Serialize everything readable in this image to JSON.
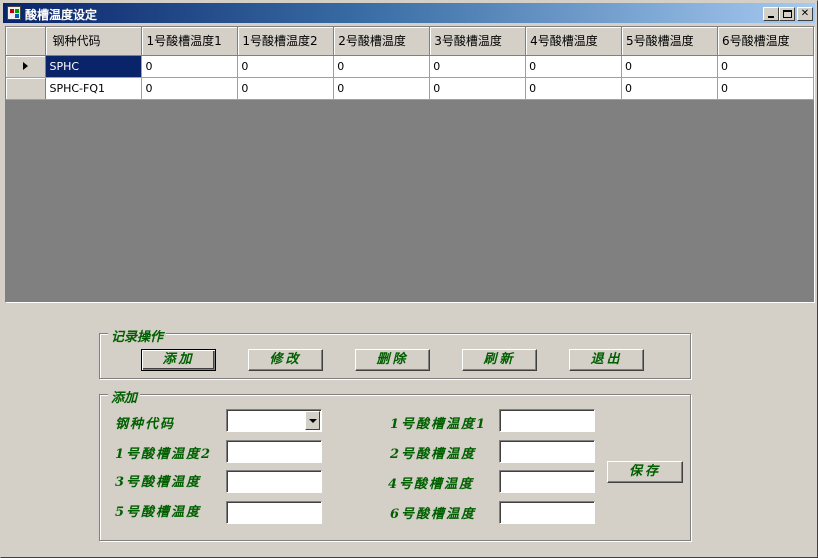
{
  "window": {
    "title": "酸槽温度设定"
  },
  "grid": {
    "columns": [
      "钢种代码",
      "1号酸槽温度1",
      "1号酸槽温度2",
      "2号酸槽温度",
      "3号酸槽温度",
      "4号酸槽温度",
      "5号酸槽温度",
      "6号酸槽温度"
    ],
    "rows": [
      [
        "SPHC",
        "0",
        "0",
        "0",
        "0",
        "0",
        "0",
        "0"
      ],
      [
        "SPHC-FQ1",
        "0",
        "0",
        "0",
        "0",
        "0",
        "0",
        "0"
      ]
    ]
  },
  "record_ops": {
    "legend": "记录操作",
    "buttons": {
      "add": "添加",
      "edit": "修改",
      "delete": "删除",
      "refresh": "刷新",
      "exit": "退出"
    }
  },
  "add_form": {
    "legend": "添加",
    "labels": {
      "steel_code": "钢种代码",
      "tank1_temp1": "1号酸槽温度1",
      "tank1_temp2": "1号酸槽温度2",
      "tank2_temp": "2号酸槽温度",
      "tank3_temp": "3号酸槽温度",
      "tank4_temp": "4号酸槽温度",
      "tank5_temp": "5号酸槽温度",
      "tank6_temp": "6号酸槽温度"
    },
    "values": {
      "steel_code": "",
      "tank1_temp1": "",
      "tank1_temp2": "",
      "tank2_temp": "",
      "tank3_temp": "",
      "tank4_temp": "",
      "tank5_temp": "",
      "tank6_temp": ""
    },
    "save_label": "保存"
  }
}
